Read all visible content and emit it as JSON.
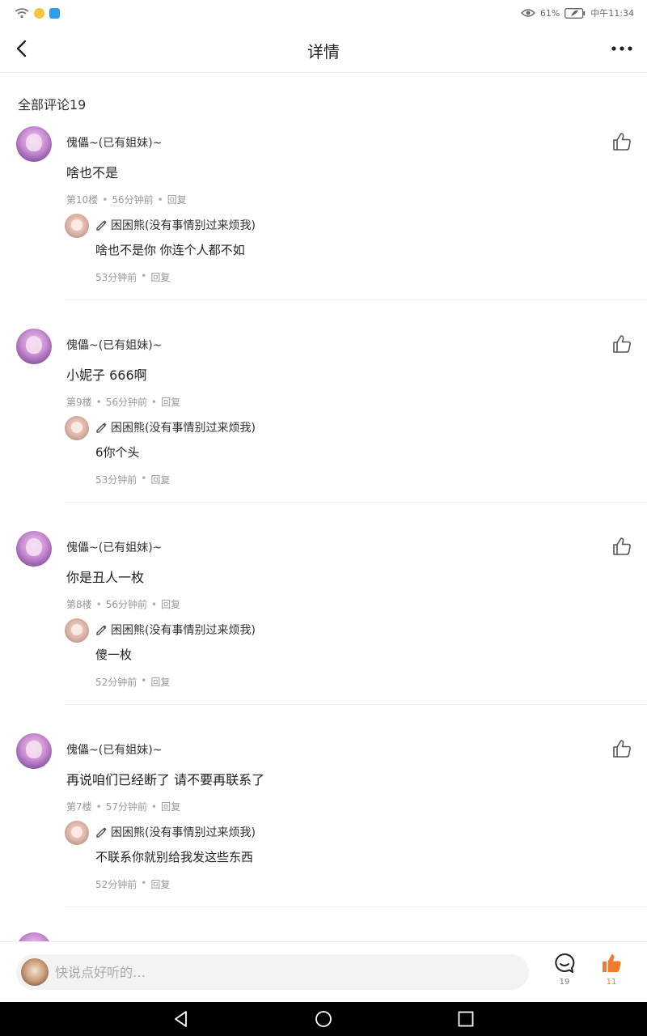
{
  "status_bar": {
    "battery": "61%",
    "time": "中午11:34"
  },
  "header": {
    "title": "详情"
  },
  "section": {
    "title": "全部评论19"
  },
  "comments": [
    {
      "username": "傀儡~(已有姐妹)~",
      "text": "啥也不是",
      "floor": "第10楼",
      "time": "56分钟前",
      "reply_label": "回复",
      "reply": {
        "username": "困困熊(没有事情别过来烦我)",
        "text": "啥也不是你 你连个人都不如",
        "time": "53分钟前",
        "reply_label": "回复"
      }
    },
    {
      "username": "傀儡~(已有姐妹)~",
      "text": "小妮子 666啊",
      "floor": "第9楼",
      "time": "56分钟前",
      "reply_label": "回复",
      "reply": {
        "username": "困困熊(没有事情别过来烦我)",
        "text": "6你个头",
        "time": "53分钟前",
        "reply_label": "回复"
      }
    },
    {
      "username": "傀儡~(已有姐妹)~",
      "text": "你是丑人一枚",
      "floor": "第8楼",
      "time": "56分钟前",
      "reply_label": "回复",
      "reply": {
        "username": "困困熊(没有事情别过来烦我)",
        "text": "傻一枚",
        "time": "52分钟前",
        "reply_label": "回复"
      }
    },
    {
      "username": "傀儡~(已有姐妹)~",
      "text": "再说咱们已经断了 请不要再联系了",
      "floor": "第7楼",
      "time": "57分钟前",
      "reply_label": "回复",
      "reply": {
        "username": "困困熊(没有事情别过来烦我)",
        "text": "不联系你就别给我发这些东西",
        "time": "52分钟前",
        "reply_label": "回复"
      }
    }
  ],
  "input_bar": {
    "placeholder": "快说点好听的…",
    "comment_count": "19",
    "like_count": "11"
  },
  "colors": {
    "accent": "#f07c2b",
    "meta_text": "#999999",
    "divider": "#eeeeee"
  },
  "icons": [
    "wifi-icon",
    "app-notification-icon",
    "eye-icon",
    "battery-icon",
    "back-icon",
    "more-icon",
    "thumbs-up-icon",
    "pencil-icon",
    "comment-bubble-icon",
    "thumbs-up-filled-icon",
    "system-back-icon",
    "system-home-icon",
    "system-recent-icon"
  ]
}
